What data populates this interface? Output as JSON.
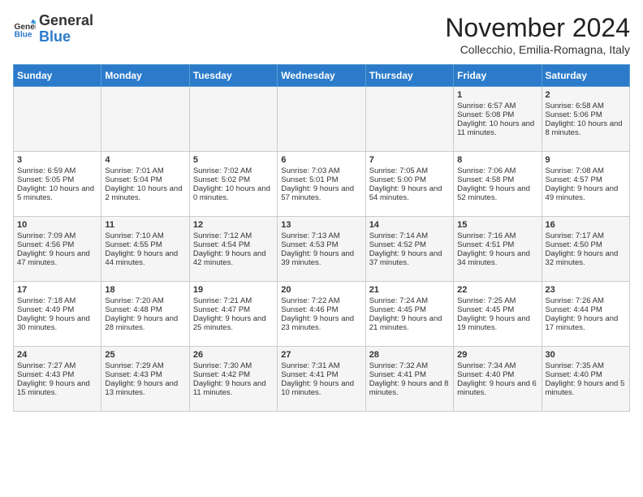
{
  "header": {
    "logo_line1": "General",
    "logo_line2": "Blue",
    "month_year": "November 2024",
    "location": "Collecchio, Emilia-Romagna, Italy"
  },
  "days_of_week": [
    "Sunday",
    "Monday",
    "Tuesday",
    "Wednesday",
    "Thursday",
    "Friday",
    "Saturday"
  ],
  "weeks": [
    [
      {
        "day": "",
        "info": ""
      },
      {
        "day": "",
        "info": ""
      },
      {
        "day": "",
        "info": ""
      },
      {
        "day": "",
        "info": ""
      },
      {
        "day": "",
        "info": ""
      },
      {
        "day": "1",
        "info": "Sunrise: 6:57 AM\nSunset: 5:08 PM\nDaylight: 10 hours and 11 minutes."
      },
      {
        "day": "2",
        "info": "Sunrise: 6:58 AM\nSunset: 5:06 PM\nDaylight: 10 hours and 8 minutes."
      }
    ],
    [
      {
        "day": "3",
        "info": "Sunrise: 6:59 AM\nSunset: 5:05 PM\nDaylight: 10 hours and 5 minutes."
      },
      {
        "day": "4",
        "info": "Sunrise: 7:01 AM\nSunset: 5:04 PM\nDaylight: 10 hours and 2 minutes."
      },
      {
        "day": "5",
        "info": "Sunrise: 7:02 AM\nSunset: 5:02 PM\nDaylight: 10 hours and 0 minutes."
      },
      {
        "day": "6",
        "info": "Sunrise: 7:03 AM\nSunset: 5:01 PM\nDaylight: 9 hours and 57 minutes."
      },
      {
        "day": "7",
        "info": "Sunrise: 7:05 AM\nSunset: 5:00 PM\nDaylight: 9 hours and 54 minutes."
      },
      {
        "day": "8",
        "info": "Sunrise: 7:06 AM\nSunset: 4:58 PM\nDaylight: 9 hours and 52 minutes."
      },
      {
        "day": "9",
        "info": "Sunrise: 7:08 AM\nSunset: 4:57 PM\nDaylight: 9 hours and 49 minutes."
      }
    ],
    [
      {
        "day": "10",
        "info": "Sunrise: 7:09 AM\nSunset: 4:56 PM\nDaylight: 9 hours and 47 minutes."
      },
      {
        "day": "11",
        "info": "Sunrise: 7:10 AM\nSunset: 4:55 PM\nDaylight: 9 hours and 44 minutes."
      },
      {
        "day": "12",
        "info": "Sunrise: 7:12 AM\nSunset: 4:54 PM\nDaylight: 9 hours and 42 minutes."
      },
      {
        "day": "13",
        "info": "Sunrise: 7:13 AM\nSunset: 4:53 PM\nDaylight: 9 hours and 39 minutes."
      },
      {
        "day": "14",
        "info": "Sunrise: 7:14 AM\nSunset: 4:52 PM\nDaylight: 9 hours and 37 minutes."
      },
      {
        "day": "15",
        "info": "Sunrise: 7:16 AM\nSunset: 4:51 PM\nDaylight: 9 hours and 34 minutes."
      },
      {
        "day": "16",
        "info": "Sunrise: 7:17 AM\nSunset: 4:50 PM\nDaylight: 9 hours and 32 minutes."
      }
    ],
    [
      {
        "day": "17",
        "info": "Sunrise: 7:18 AM\nSunset: 4:49 PM\nDaylight: 9 hours and 30 minutes."
      },
      {
        "day": "18",
        "info": "Sunrise: 7:20 AM\nSunset: 4:48 PM\nDaylight: 9 hours and 28 minutes."
      },
      {
        "day": "19",
        "info": "Sunrise: 7:21 AM\nSunset: 4:47 PM\nDaylight: 9 hours and 25 minutes."
      },
      {
        "day": "20",
        "info": "Sunrise: 7:22 AM\nSunset: 4:46 PM\nDaylight: 9 hours and 23 minutes."
      },
      {
        "day": "21",
        "info": "Sunrise: 7:24 AM\nSunset: 4:45 PM\nDaylight: 9 hours and 21 minutes."
      },
      {
        "day": "22",
        "info": "Sunrise: 7:25 AM\nSunset: 4:45 PM\nDaylight: 9 hours and 19 minutes."
      },
      {
        "day": "23",
        "info": "Sunrise: 7:26 AM\nSunset: 4:44 PM\nDaylight: 9 hours and 17 minutes."
      }
    ],
    [
      {
        "day": "24",
        "info": "Sunrise: 7:27 AM\nSunset: 4:43 PM\nDaylight: 9 hours and 15 minutes."
      },
      {
        "day": "25",
        "info": "Sunrise: 7:29 AM\nSunset: 4:43 PM\nDaylight: 9 hours and 13 minutes."
      },
      {
        "day": "26",
        "info": "Sunrise: 7:30 AM\nSunset: 4:42 PM\nDaylight: 9 hours and 11 minutes."
      },
      {
        "day": "27",
        "info": "Sunrise: 7:31 AM\nSunset: 4:41 PM\nDaylight: 9 hours and 10 minutes."
      },
      {
        "day": "28",
        "info": "Sunrise: 7:32 AM\nSunset: 4:41 PM\nDaylight: 9 hours and 8 minutes."
      },
      {
        "day": "29",
        "info": "Sunrise: 7:34 AM\nSunset: 4:40 PM\nDaylight: 9 hours and 6 minutes."
      },
      {
        "day": "30",
        "info": "Sunrise: 7:35 AM\nSunset: 4:40 PM\nDaylight: 9 hours and 5 minutes."
      }
    ]
  ]
}
